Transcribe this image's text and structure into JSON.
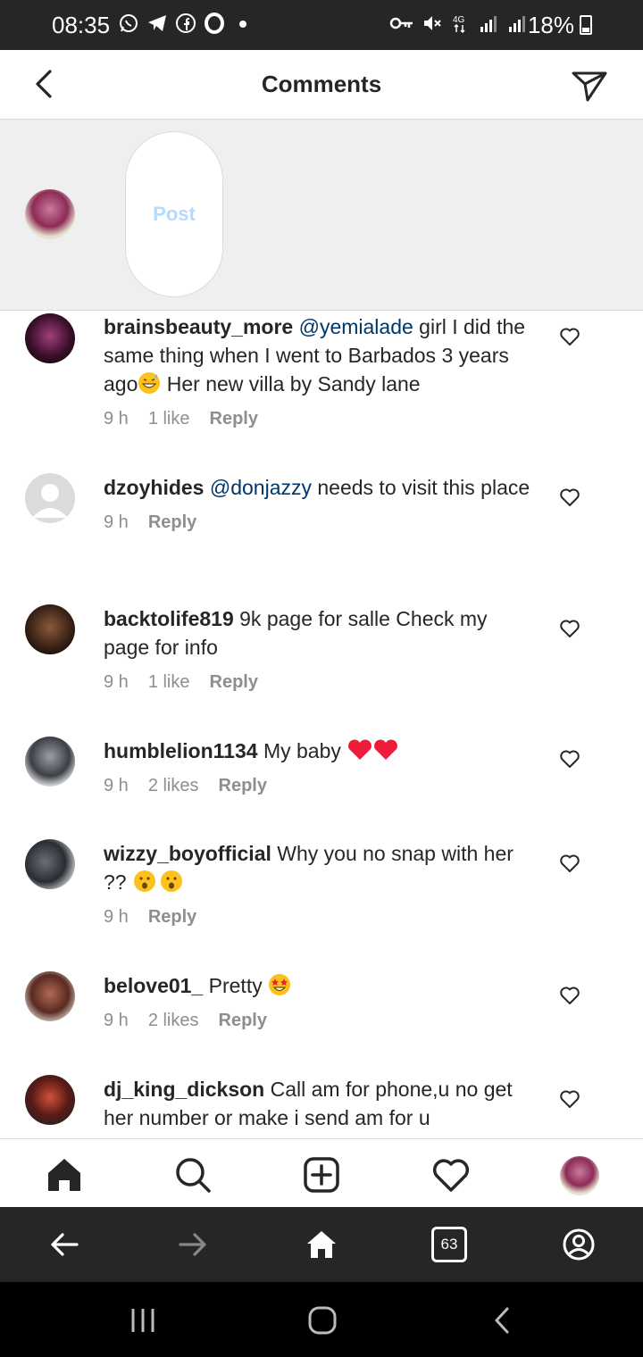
{
  "status_bar": {
    "time": "08:35",
    "battery": "18%",
    "network": "4G"
  },
  "header": {
    "title": "Comments"
  },
  "compose": {
    "post_label": "Post"
  },
  "comments": [
    {
      "username": "brainsbeauty_more",
      "mention": "@yemialade",
      "text_after_mention": " girl I did the same thing when I went to Barbados 3 years ago",
      "text_after_emoji": " Her new villa by Sandy lane",
      "emoji": "grinning-sweat",
      "time": "9 h",
      "likes": "1 like",
      "reply": "Reply"
    },
    {
      "username": "dzoyhides",
      "mention": "@donjazzy",
      "text_after_mention": " needs to visit this place",
      "time": "9 h",
      "reply": "Reply"
    },
    {
      "username": "backtolife819",
      "text": " 9k page for salle Check my page for info",
      "time": "9 h",
      "likes": "1 like",
      "reply": "Reply"
    },
    {
      "username": "humblelion1134",
      "text": " My baby ",
      "emoji": "two-red-hearts",
      "time": "9 h",
      "likes": "2 likes",
      "reply": "Reply"
    },
    {
      "username": "wizzy_boyofficial",
      "text": " Why you no snap with her ?? ",
      "emoji": "two-hushed-faces",
      "time": "9 h",
      "reply": "Reply"
    },
    {
      "username": "belove01_",
      "text": " Pretty ",
      "emoji": "star-struck",
      "time": "9 h",
      "likes": "2 likes",
      "reply": "Reply"
    },
    {
      "username": "dj_king_dickson",
      "text": " Call am for phone,u no get her number or make i send am for u"
    }
  ],
  "browser_bar": {
    "tab_count": "63"
  },
  "colors": {
    "status_bg": "#262626",
    "compose_bg": "#efefef",
    "post_disabled": "#b3dbff",
    "mention": "#00376b",
    "meta_gray": "#8e8e8e",
    "heart_red": "#ed1c3a"
  }
}
